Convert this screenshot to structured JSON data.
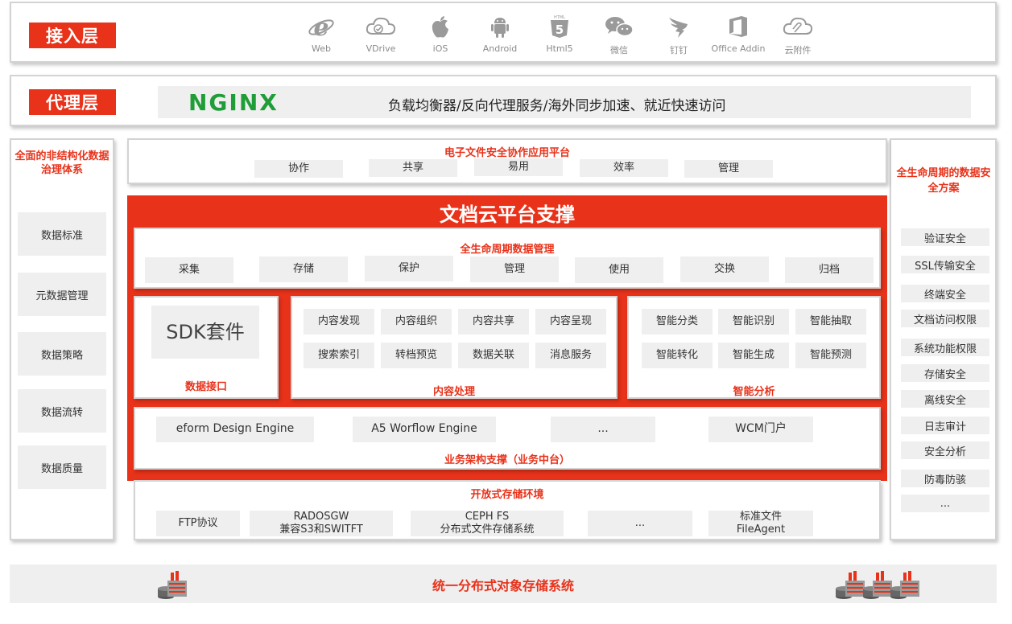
{
  "access_layer": {
    "label": "接入层",
    "clients": [
      {
        "icon": "ie-icon",
        "label": "Web"
      },
      {
        "icon": "cloud-check-icon",
        "label": "VDrive"
      },
      {
        "icon": "apple-icon",
        "label": "iOS"
      },
      {
        "icon": "android-icon",
        "label": "Android"
      },
      {
        "icon": "html5-icon",
        "label": "Html5"
      },
      {
        "icon": "wechat-icon",
        "label": "微信"
      },
      {
        "icon": "dingtalk-icon",
        "label": "钉钉"
      },
      {
        "icon": "office-icon",
        "label": "Office Addin"
      },
      {
        "icon": "cloud-attachment-icon",
        "label": "云附件"
      }
    ]
  },
  "proxy_layer": {
    "label": "代理层",
    "logo_text": "NGINX",
    "description": "负载均衡器/反向代理服务/海外同步加速、就近快速访问"
  },
  "left_panel": {
    "title": "全面的非结构化数据治理体系",
    "items": [
      "数据标准",
      "元数据管理",
      "数据策略",
      "数据流转",
      "数据质量"
    ]
  },
  "right_panel": {
    "title": "全生命周期的数据安全方案",
    "items": [
      "验证安全",
      "SSL传输安全",
      "终端安全",
      "文档访问权限",
      "系统功能权限",
      "存储安全",
      "离线安全",
      "日志审计",
      "安全分析",
      "防毒防骇",
      "..."
    ]
  },
  "app_platform": {
    "title": "电子文件安全协作应用平台",
    "items": [
      "协作",
      "共享",
      "易用",
      "效率",
      "管理"
    ]
  },
  "doc_cloud": {
    "title": "文档云平台支撑",
    "lifecycle": {
      "title": "全生命周期数据管理",
      "items": [
        "采集",
        "存储",
        "保护",
        "管理",
        "使用",
        "交换",
        "归档"
      ]
    },
    "data_interface": {
      "sdk_label": "SDK套件",
      "title": "数据接口"
    },
    "content_processing": {
      "title": "内容处理",
      "items": [
        "内容发现",
        "内容组织",
        "内容共享",
        "内容呈现",
        "搜索索引",
        "转档预览",
        "数据关联",
        "消息服务"
      ]
    },
    "intelligent_analysis": {
      "title": "智能分析",
      "items": [
        "智能分类",
        "智能识别",
        "智能抽取",
        "智能转化",
        "智能生成",
        "智能预测"
      ]
    },
    "business": {
      "title": "业务架构支撑（业务中台）",
      "items": [
        "eform Design Engine",
        "A5 Worflow Engine",
        "...",
        "WCM门户"
      ]
    }
  },
  "storage_env": {
    "title": "开放式存储环境",
    "items": [
      {
        "line1": "FTP协议",
        "line2": ""
      },
      {
        "line1": "RADOSGW",
        "line2": "兼容S3和SWITFT"
      },
      {
        "line1": "CEPH FS",
        "line2": "分布式文件存储系统"
      },
      {
        "line1": "...",
        "line2": ""
      },
      {
        "line1": "标准文件",
        "line2": "FileAgent"
      }
    ]
  },
  "object_storage": {
    "title": "统一分布式对象存储系统"
  },
  "colors": {
    "accent_red": "#e8321a",
    "nginx_green": "#1f9e37",
    "chip_gray": "#efefef",
    "icon_gray": "#9a9a9a"
  }
}
